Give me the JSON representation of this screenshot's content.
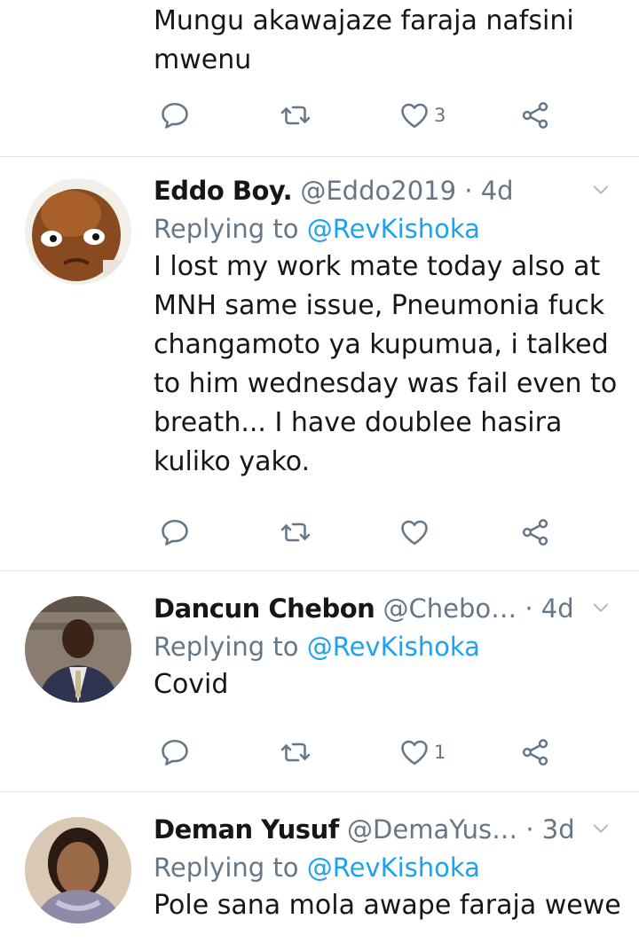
{
  "colors": {
    "accent": "#1da1f2",
    "muted": "#657786",
    "text": "#14171a",
    "divider": "#dfe3e6"
  },
  "top_tweet": {
    "text_lines": [
      "Mungu akawajaze faraja nafsini",
      "mwenu"
    ],
    "like_count": "3"
  },
  "tweets": [
    {
      "name": "Eddo Boy.",
      "handle": "@Eddo2019",
      "sep": " · ",
      "time": "4d",
      "replying_prefix": "Replying to ",
      "replying_to": "@RevKishoka",
      "text_lines": [
        "I lost my work mate today also at",
        "MNH same issue, Pneumonia fuck",
        "changamoto ya kupumua, i talked",
        "to him wednesday was fail even to",
        "breath... I have doublee hasira",
        "kuliko yako."
      ],
      "like_count": ""
    },
    {
      "name": "Dancun Chebon",
      "handle": "@Chebo…",
      "sep": " · ",
      "time": "4d",
      "replying_prefix": "Replying to ",
      "replying_to": "@RevKishoka",
      "text_lines": [
        "Covid"
      ],
      "like_count": "1"
    },
    {
      "name": "Deman Yusuf",
      "handle": "@DemaYus…",
      "sep": " · ",
      "time": "3d",
      "replying_prefix": "Replying to ",
      "replying_to": "@RevKishoka",
      "text_lines": [
        "Pole sana mola awape faraja wewe"
      ],
      "like_count": ""
    }
  ],
  "icons": {
    "reply": "reply-icon",
    "retweet": "retweet-icon",
    "like": "heart-icon",
    "share": "share-icon",
    "more": "chevron-down-icon"
  }
}
